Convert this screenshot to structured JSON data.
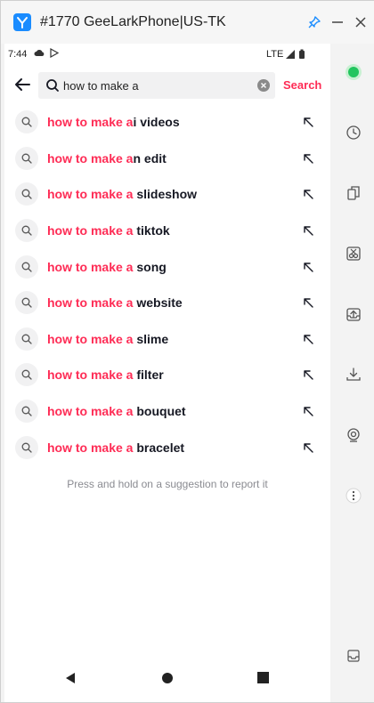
{
  "window": {
    "title": "#1770 GeeLarkPhone|US-TK",
    "accent_color": "#1a8cff"
  },
  "status_bar": {
    "time": "7:44",
    "network": "LTE"
  },
  "search": {
    "query": "how to make a",
    "button_label": "Search",
    "highlight_color": "#fe2c55"
  },
  "suggestions": [
    {
      "prefix": "how to make a",
      "suffix": "i videos"
    },
    {
      "prefix": "how to make a",
      "suffix": "n edit"
    },
    {
      "prefix": "how to make a",
      "suffix": " slideshow"
    },
    {
      "prefix": "how to make a",
      "suffix": " tiktok"
    },
    {
      "prefix": "how to make a",
      "suffix": " song"
    },
    {
      "prefix": "how to make a",
      "suffix": " website"
    },
    {
      "prefix": "how to make a",
      "suffix": " slime"
    },
    {
      "prefix": "how to make a",
      "suffix": " filter"
    },
    {
      "prefix": "how to make a",
      "suffix": " bouquet"
    },
    {
      "prefix": "how to make a",
      "suffix": " bracelet"
    }
  ],
  "hint": "Press and hold on a suggestion to report it",
  "sidebar": {
    "icons": [
      "status-indicator-icon",
      "history-icon",
      "copy-icon",
      "screenshot-icon",
      "upload-icon",
      "download-icon",
      "camera-icon",
      "more-icon",
      "inbox-icon"
    ],
    "status_color": "#22c55e"
  }
}
